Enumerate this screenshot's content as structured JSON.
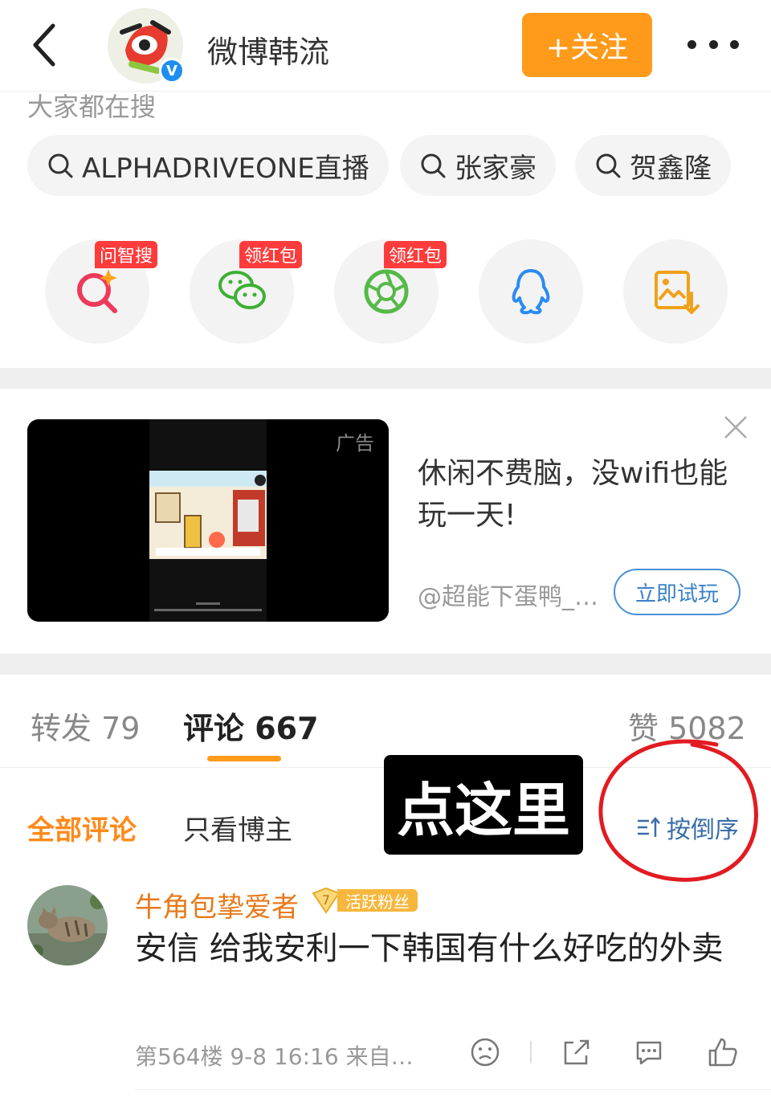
{
  "header": {
    "account_name": "微博韩流",
    "verified_mark": "V",
    "follow_label": "+关注"
  },
  "search": {
    "title": "大家都在搜",
    "chips": [
      "ALPHADRIVEONE直播",
      "张家豪",
      "贺鑫隆"
    ]
  },
  "share": {
    "items": [
      {
        "icon": "ai-search-icon",
        "tag": "问智搜"
      },
      {
        "icon": "wechat-icon",
        "tag": "领红包"
      },
      {
        "icon": "moments-icon",
        "tag": "领红包"
      },
      {
        "icon": "qq-icon",
        "tag": ""
      },
      {
        "icon": "save-image-icon",
        "tag": ""
      }
    ]
  },
  "ad": {
    "label": "广告",
    "text": "休闲不费脑，没wifi也能玩一天!",
    "source": "@超能下蛋鸭_…",
    "cta": "立即试玩"
  },
  "tabs": {
    "repost": "转发 79",
    "comments": "评论 667",
    "likes": "赞 5082"
  },
  "filters": {
    "all": "全部评论",
    "author_only": "只看博主",
    "sort": "按倒序"
  },
  "overlay": {
    "label": "点这里"
  },
  "comment": {
    "user": "牛角包挚爱者",
    "fan_level": "7",
    "fan_badge": "活跃粉丝",
    "text": "安信 给我安利一下韩国有什么好吃的外卖",
    "meta": "第564楼 9-8 16:16 来自…"
  },
  "colors": {
    "accent_orange": "#ff9a1a",
    "link_blue": "#3a80c9",
    "annotation_red": "#e21b22"
  }
}
